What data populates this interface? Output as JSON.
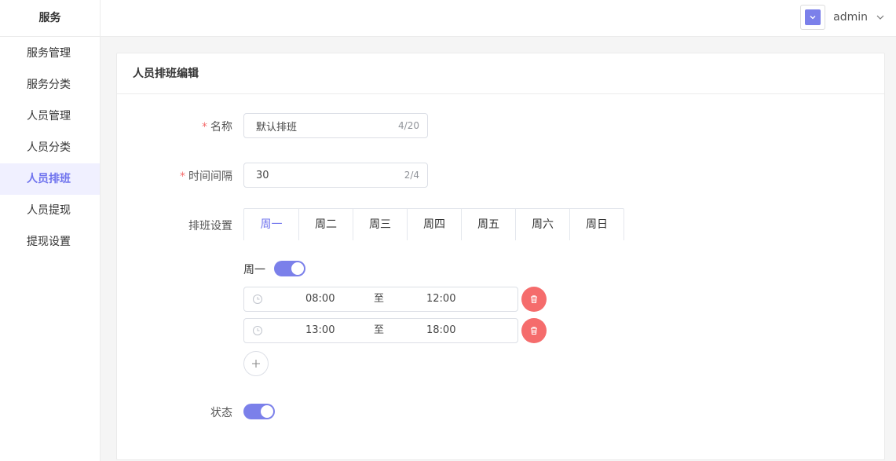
{
  "sidebar": {
    "title": "服务",
    "items": [
      {
        "label": "服务管理"
      },
      {
        "label": "服务分类"
      },
      {
        "label": "人员管理"
      },
      {
        "label": "人员分类"
      },
      {
        "label": "人员排班"
      },
      {
        "label": "人员提现"
      },
      {
        "label": "提现设置"
      }
    ]
  },
  "header": {
    "username": "admin"
  },
  "card": {
    "title": "人员排班编辑"
  },
  "form": {
    "name": {
      "label": "名称",
      "value": "默认排班",
      "count": "4/20"
    },
    "interval": {
      "label": "时间间隔",
      "value": "30",
      "count": "2/4"
    },
    "schedule": {
      "label": "排班设置"
    },
    "status": {
      "label": "状态",
      "enabled": true
    }
  },
  "tabs": [
    "周一",
    "周二",
    "周三",
    "周四",
    "周五",
    "周六",
    "周日"
  ],
  "day_panel": {
    "day_label": "周一",
    "enabled": true,
    "ranges": [
      {
        "start": "08:00",
        "sep": "至",
        "end": "12:00"
      },
      {
        "start": "13:00",
        "sep": "至",
        "end": "18:00"
      }
    ]
  },
  "colors": {
    "accent": "#7b80ea",
    "danger": "#f56c6c"
  }
}
